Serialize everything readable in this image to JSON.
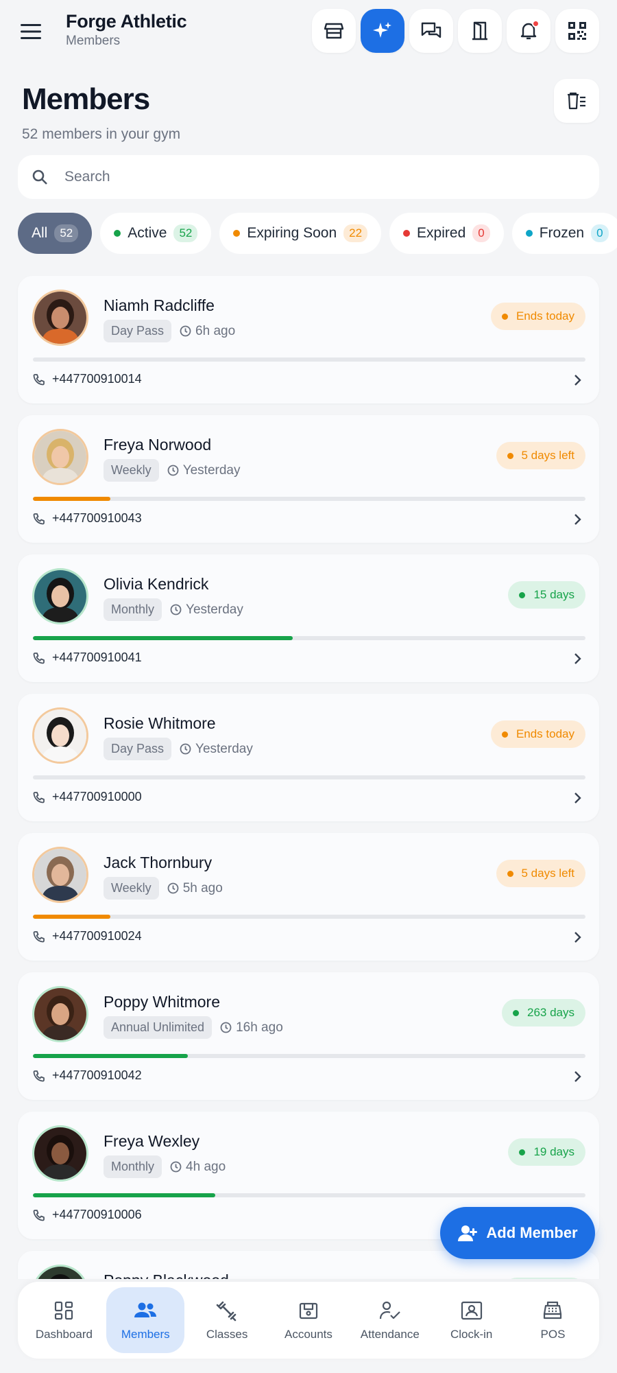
{
  "app": {
    "name": "Forge Athletic",
    "section": "Members"
  },
  "header": {
    "title": "Members",
    "subtitle": "52 members in your gym"
  },
  "search": {
    "placeholder": "Search",
    "value": ""
  },
  "chips": [
    {
      "label": "All",
      "count": "52",
      "active": true,
      "dot_color": "",
      "count_bg": "",
      "count_color": ""
    },
    {
      "label": "Active",
      "count": "52",
      "dot_color": "#17a34a",
      "count_bg": "#dcf3e6",
      "count_color": "#17a34a"
    },
    {
      "label": "Expiring Soon",
      "count": "22",
      "dot_color": "#f08a00",
      "count_bg": "#fdebd6",
      "count_color": "#f08a00"
    },
    {
      "label": "Expired",
      "count": "0",
      "dot_color": "#e53935",
      "count_bg": "#fde2e2",
      "count_color": "#e53935"
    },
    {
      "label": "Frozen",
      "count": "0",
      "dot_color": "#0ea5c7",
      "count_bg": "#d7f1f8",
      "count_color": "#0ea5c7"
    }
  ],
  "members": [
    {
      "name": "Niamh Radcliffe",
      "plan": "Day Pass",
      "last_seen": "6h ago",
      "status": "Ends today",
      "status_tone": "orange",
      "progress": 0,
      "phone": "+447700910014"
    },
    {
      "name": "Freya Norwood",
      "plan": "Weekly",
      "last_seen": "Yesterday",
      "status": "5 days left",
      "status_tone": "orange",
      "progress": 0.14,
      "phone": "+447700910043"
    },
    {
      "name": "Olivia Kendrick",
      "plan": "Monthly",
      "last_seen": "Yesterday",
      "status": "15 days",
      "status_tone": "green",
      "progress": 0.47,
      "phone": "+447700910041"
    },
    {
      "name": "Rosie Whitmore",
      "plan": "Day Pass",
      "last_seen": "Yesterday",
      "status": "Ends today",
      "status_tone": "orange",
      "progress": 0,
      "phone": "+447700910000"
    },
    {
      "name": "Jack Thornbury",
      "plan": "Weekly",
      "last_seen": "5h ago",
      "status": "5 days left",
      "status_tone": "orange",
      "progress": 0.14,
      "phone": "+447700910024"
    },
    {
      "name": "Poppy Whitmore",
      "plan": "Annual Unlimited",
      "last_seen": "16h ago",
      "status": "263 days",
      "status_tone": "green",
      "progress": 0.28,
      "phone": "+447700910042"
    },
    {
      "name": "Freya Wexley",
      "plan": "Monthly",
      "last_seen": "4h ago",
      "status": "19 days",
      "status_tone": "green",
      "progress": 0.33,
      "phone": "+447700910006"
    },
    {
      "name": "Poppy Blackwood",
      "plan": "",
      "last_seen": "",
      "status": "",
      "status_tone": "green",
      "progress": 0,
      "phone": ""
    }
  ],
  "fab": {
    "label": "Add Member"
  },
  "nav": [
    {
      "label": "Dashboard",
      "icon": "dashboard-icon"
    },
    {
      "label": "Members",
      "icon": "members-icon",
      "active": true
    },
    {
      "label": "Classes",
      "icon": "dumbbell-icon"
    },
    {
      "label": "Accounts",
      "icon": "wallet-icon"
    },
    {
      "label": "Attendance",
      "icon": "attendance-icon"
    },
    {
      "label": "Clock-in",
      "icon": "clock-in-icon"
    },
    {
      "label": "POS",
      "icon": "register-icon"
    }
  ],
  "colors": {
    "primary": "#1d6fe4",
    "orange": "#f08a00",
    "green": "#17a34a",
    "chip_active": "#5d6b86"
  }
}
